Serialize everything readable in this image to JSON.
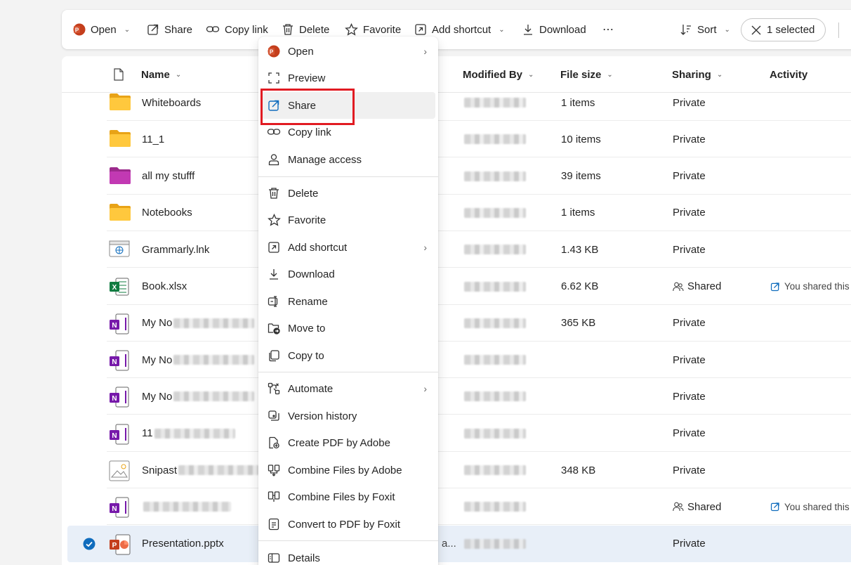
{
  "toolbar": {
    "open": "Open",
    "share": "Share",
    "copy_link": "Copy link",
    "delete": "Delete",
    "favorite": "Favorite",
    "add_shortcut": "Add shortcut",
    "download": "Download",
    "more": "⋯",
    "sort": "Sort",
    "selected": "1 selected"
  },
  "columns": {
    "name": "Name",
    "modified_by": "Modified By",
    "file_size": "File size",
    "sharing": "Sharing",
    "activity": "Activity"
  },
  "files": [
    {
      "name": "Whiteboards",
      "type": "folder-yellow",
      "size": "1 items",
      "sharing": "Private",
      "activity": ""
    },
    {
      "name": "11_1",
      "type": "folder-yellow",
      "size": "10 items",
      "sharing": "Private",
      "activity": ""
    },
    {
      "name": "all my stufff",
      "type": "folder-pink",
      "size": "39 items",
      "sharing": "Private",
      "activity": ""
    },
    {
      "name": "Notebooks",
      "type": "folder-yellow",
      "size": "1 items",
      "sharing": "Private",
      "activity": ""
    },
    {
      "name": "Grammarly.lnk",
      "type": "link",
      "size": "1.43 KB",
      "sharing": "Private",
      "activity": ""
    },
    {
      "name": "Book.xlsx",
      "type": "excel",
      "size": "6.62 KB",
      "sharing": "Shared",
      "activity": "You shared this f"
    },
    {
      "name": "My No",
      "type": "onenote",
      "size": "365 KB",
      "sharing": "Private",
      "activity": ""
    },
    {
      "name": "My No",
      "type": "onenote",
      "size": "",
      "sharing": "Private",
      "activity": ""
    },
    {
      "name": "My No",
      "type": "onenote",
      "size": "",
      "sharing": "Private",
      "activity": ""
    },
    {
      "name": "11",
      "type": "onenote",
      "size": "",
      "sharing": "Private",
      "activity": ""
    },
    {
      "name": "Snipast",
      "type": "image",
      "size": "348 KB",
      "sharing": "Private",
      "activity": ""
    },
    {
      "name": "",
      "type": "onenote",
      "size": "",
      "sharing": "Shared",
      "activity": "You shared this f"
    },
    {
      "name": "Presentation.pptx",
      "type": "powerpoint",
      "size": "",
      "sharing": "Private",
      "activity": "",
      "selected": true,
      "modified_extra": "a..."
    }
  ],
  "context_menu": {
    "items": [
      {
        "label": "Open",
        "icon": "powerpoint-icon",
        "submenu": true
      },
      {
        "label": "Preview",
        "icon": "preview-icon"
      },
      {
        "label": "Share",
        "icon": "share-icon",
        "highlighted": true
      },
      {
        "label": "Copy link",
        "icon": "link-icon"
      },
      {
        "label": "Manage access",
        "icon": "person-icon"
      },
      {
        "label": "Delete",
        "icon": "trash-icon"
      },
      {
        "label": "Favorite",
        "icon": "star-icon"
      },
      {
        "label": "Add shortcut",
        "icon": "shortcut-icon",
        "submenu": true
      },
      {
        "label": "Download",
        "icon": "download-icon"
      },
      {
        "label": "Rename",
        "icon": "rename-icon"
      },
      {
        "label": "Move to",
        "icon": "move-icon"
      },
      {
        "label": "Copy to",
        "icon": "copy-icon"
      },
      {
        "label": "Automate",
        "icon": "automate-icon",
        "submenu": true
      },
      {
        "label": "Version history",
        "icon": "history-icon"
      },
      {
        "label": "Create PDF by Adobe",
        "icon": "pdf-icon"
      },
      {
        "label": "Combine Files by Adobe",
        "icon": "combine-icon"
      },
      {
        "label": "Combine Files by Foxit",
        "icon": "combine-foxit-icon"
      },
      {
        "label": "Convert to PDF by Foxit",
        "icon": "convert-icon"
      },
      {
        "label": "Details",
        "icon": "details-icon"
      }
    ]
  },
  "colors": {
    "accent": "#0f6cbd",
    "highlight_box": "#e11b22",
    "powerpoint": "#c43e1c",
    "excel": "#107c41",
    "onenote": "#7719aa"
  }
}
